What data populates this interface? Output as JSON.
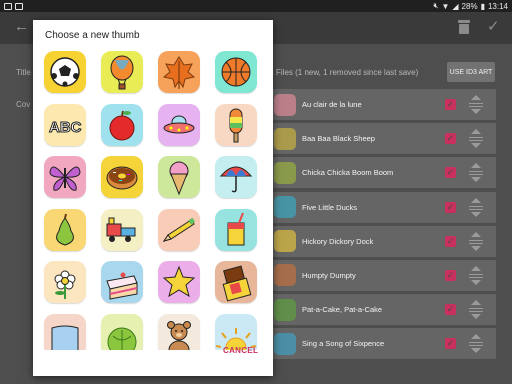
{
  "status_bar": {
    "battery_percent": "28%",
    "time": "13:14"
  },
  "app_bar": {
    "back_icon": "arrow-left-icon",
    "delete_icon": "trash-icon",
    "confirm_icon": "check-icon"
  },
  "form": {
    "title_label": "Title",
    "cover_label": "Cov",
    "files_info": "Files (1 new, 1 removed since last save)",
    "id3_button": "USE ID3 ART"
  },
  "tracks": [
    {
      "title": "Au clair de la lune",
      "checked": true
    },
    {
      "title": "Baa Baa Black Sheep",
      "checked": true
    },
    {
      "title": "Chicka Chicka Boom Boom",
      "checked": true
    },
    {
      "title": "Five Little Ducks",
      "checked": true
    },
    {
      "title": "Hickory Dickory Dock",
      "checked": true
    },
    {
      "title": "Humpty Dumpty",
      "checked": true
    },
    {
      "title": "Pat-a-Cake, Pat-a-Cake",
      "checked": true
    },
    {
      "title": "Sing a Song of Sixpence",
      "checked": true
    }
  ],
  "dialog": {
    "title": "Choose a new thumb",
    "cancel_label": "CANCEL",
    "thumbs": [
      {
        "name": "soccer-ball",
        "bg": "#f6d233"
      },
      {
        "name": "hot-air-balloon",
        "bg": "#e9ec55"
      },
      {
        "name": "autumn-leaf",
        "bg": "#f6a25a"
      },
      {
        "name": "basketball",
        "bg": "#7fe7d2"
      },
      {
        "name": "abc-letters",
        "bg": "#fde9b0"
      },
      {
        "name": "apple",
        "bg": "#9fe2ee"
      },
      {
        "name": "ufo",
        "bg": "#e6b2ef"
      },
      {
        "name": "ice-pop",
        "bg": "#f8d7c3"
      },
      {
        "name": "butterfly",
        "bg": "#f2a7c1"
      },
      {
        "name": "donut",
        "bg": "#f4d438"
      },
      {
        "name": "ice-cream-cone",
        "bg": "#cde79b"
      },
      {
        "name": "umbrella",
        "bg": "#c4eef0"
      },
      {
        "name": "pear",
        "bg": "#f9d775"
      },
      {
        "name": "toy-train",
        "bg": "#f5efc4"
      },
      {
        "name": "pencil",
        "bg": "#f9ccb7"
      },
      {
        "name": "drink-cup",
        "bg": "#97e3e0"
      },
      {
        "name": "flower",
        "bg": "#fce6c0"
      },
      {
        "name": "cake-slice",
        "bg": "#a8d7ee"
      },
      {
        "name": "star",
        "bg": "#ecaee9"
      },
      {
        "name": "chocolate-bar",
        "bg": "#e8b79a"
      },
      {
        "name": "shape-1",
        "bg": "#f6d6c8"
      },
      {
        "name": "cabbage",
        "bg": "#e6f0b0"
      },
      {
        "name": "teddy-bear",
        "bg": "#f3e9dc"
      },
      {
        "name": "sun",
        "bg": "#cbe9f5"
      }
    ]
  }
}
